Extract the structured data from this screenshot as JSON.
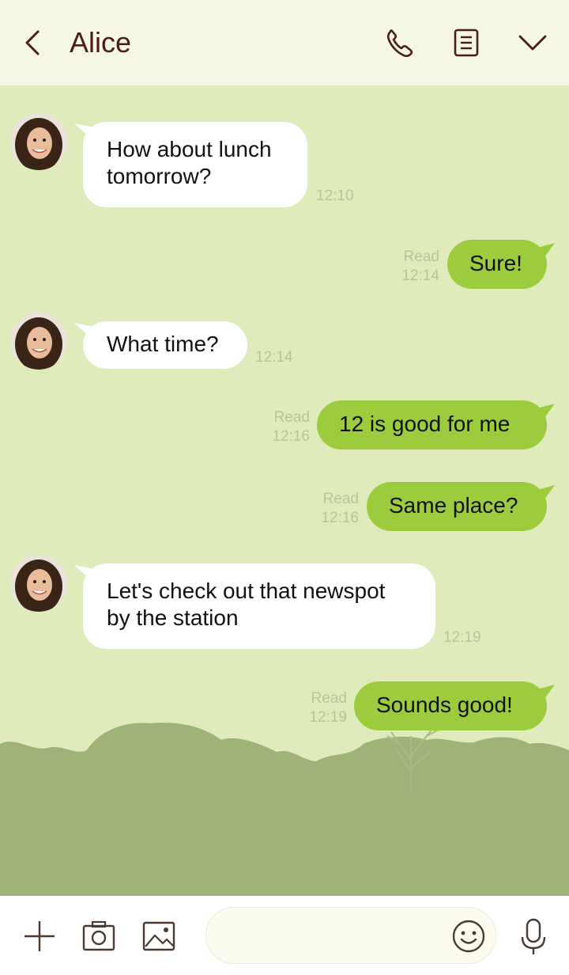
{
  "header": {
    "contact_name": "Alice",
    "icons": [
      "back-icon",
      "phone-icon",
      "notes-icon",
      "chevron-down-icon"
    ]
  },
  "messages": [
    {
      "from": "Alice",
      "direction": "incoming",
      "text_line1": "How about lunch",
      "text_line2": "tomorrow?",
      "time": "12:10"
    },
    {
      "direction": "outgoing",
      "text": "Sure!",
      "status": "Read",
      "time": "12:14"
    },
    {
      "from": "Alice",
      "direction": "incoming",
      "text": "What time?",
      "time": "12:14"
    },
    {
      "direction": "outgoing",
      "text": "12 is good for me",
      "status": "Read",
      "time": "12:16"
    },
    {
      "direction": "outgoing",
      "text": "Same place?",
      "status": "Read",
      "time": "12:16"
    },
    {
      "from": "Alice",
      "direction": "incoming",
      "text_line1": "Let's check out that newspot",
      "text_line2": "by the station",
      "time": "12:19"
    },
    {
      "direction": "outgoing",
      "text": "Sounds good!",
      "status": "Read",
      "time": "12:19"
    }
  ],
  "composer": {
    "icons": [
      "plus-icon",
      "camera-icon",
      "image-icon",
      "emoji-icon",
      "microphone-icon"
    ],
    "input_value": ""
  },
  "colors": {
    "header_bg": "#f5f6e6",
    "chat_bg": "#dfebba",
    "outgoing_bubble": "#9ccc3e",
    "incoming_bubble": "#ffffff",
    "title_text": "#4b1d16",
    "trees": "#9fb379"
  }
}
